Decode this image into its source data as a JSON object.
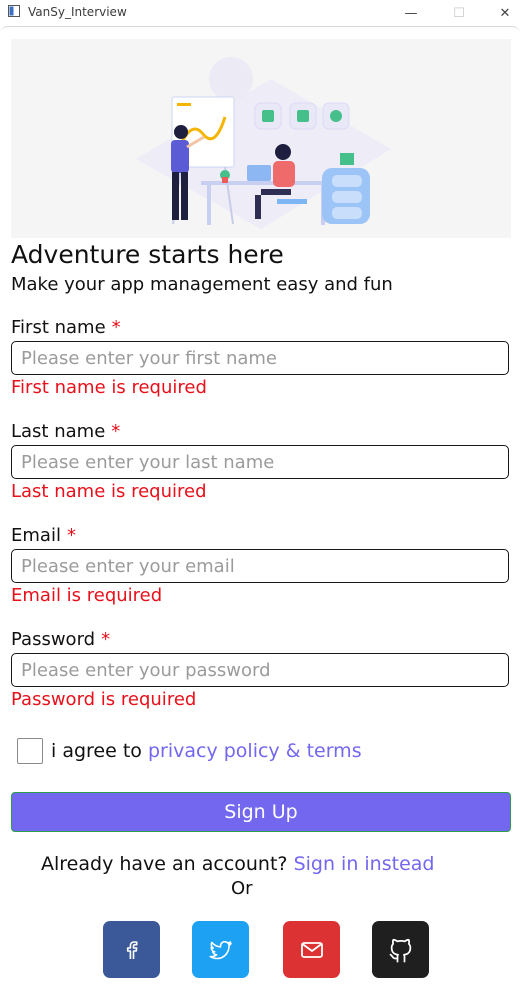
{
  "window": {
    "title": "VanSy_Interview",
    "minimize_glyph": "—",
    "maximize_glyph": "☐",
    "close_glyph": "✕"
  },
  "hero": {
    "illustration": "team-at-desk-illustration"
  },
  "heading": "Adventure starts here",
  "subheading": "Make your app management easy and fun",
  "form": {
    "required_marker": "*",
    "fields": [
      {
        "label": "First name",
        "placeholder": "Please enter your first name",
        "value": "",
        "error": "First name is required"
      },
      {
        "label": "Last name",
        "placeholder": "Please enter your last name",
        "value": "",
        "error": "Last name is required"
      },
      {
        "label": "Email",
        "placeholder": "Please enter your email",
        "value": "",
        "error": "Email is required"
      },
      {
        "label": "Password",
        "placeholder": "Please enter your password",
        "value": "",
        "error": "Password is required"
      }
    ],
    "agree_prefix": "i agree to",
    "agree_link": "privacy policy & terms",
    "agree_checked": false,
    "submit_label": "Sign Up"
  },
  "footer": {
    "already_text": "Already have an account?",
    "signin_link": "Sign in instead",
    "or_text": "Or"
  },
  "social": [
    {
      "name": "facebook",
      "icon": "facebook-icon",
      "color": "#3b5998"
    },
    {
      "name": "twitter",
      "icon": "twitter-icon",
      "color": "#1da1f2"
    },
    {
      "name": "gmail",
      "icon": "mail-icon",
      "color": "#dd3234"
    },
    {
      "name": "github",
      "icon": "github-icon",
      "color": "#1f1f1f"
    }
  ],
  "colors": {
    "accent": "#7367f0",
    "error": "#e8101a",
    "button_border": "#2e9e4e"
  }
}
